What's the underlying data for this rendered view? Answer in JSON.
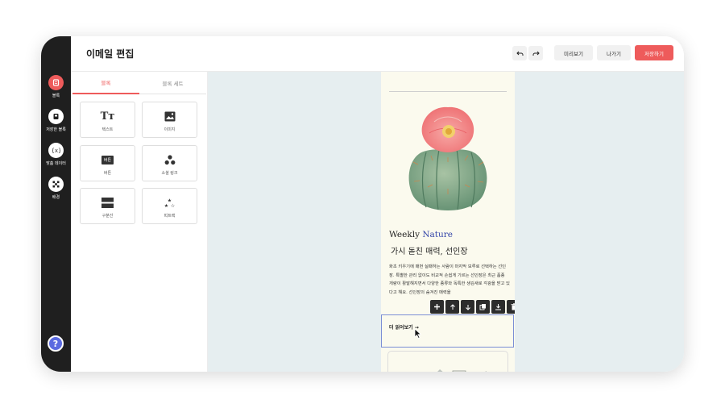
{
  "header": {
    "title": "이메일 편집",
    "preview_label": "미리보기",
    "exit_label": "나가기",
    "save_label": "저장하기"
  },
  "rail": {
    "items": [
      {
        "label": "블록",
        "icon": "block-icon",
        "active": true
      },
      {
        "label": "저장한 블록",
        "icon": "saved-block-icon",
        "active": false
      },
      {
        "label": "맞춤 데이터",
        "icon": "custom-data-icon",
        "active": false
      },
      {
        "label": "배경",
        "icon": "background-icon",
        "active": false
      }
    ],
    "help_label": "?"
  },
  "panel": {
    "tabs": [
      {
        "label": "블록",
        "active": true
      },
      {
        "label": "블록 세트",
        "active": false
      }
    ],
    "tiles": [
      {
        "label": "텍스트",
        "icon": "text-icon",
        "glyph": "Tт"
      },
      {
        "label": "이미지",
        "icon": "image-icon"
      },
      {
        "label": "버튼",
        "icon": "button-icon",
        "glyph": "버튼"
      },
      {
        "label": "소셜 링크",
        "icon": "social-link-icon"
      },
      {
        "label": "구분선",
        "icon": "divider-icon"
      },
      {
        "label": "띠트랙",
        "icon": "stars-icon"
      }
    ]
  },
  "email": {
    "title_prefix": "Weekly ",
    "title_accent": "Nature",
    "subtitle": "가시 돋친 매력, 선인장",
    "body": "화초 키우기에 매번 실패하는 사람이 마지막 보루로 선택하는 선인장. 특별한 관리 없이도 비교적 손쉽게 기르는 선인장은 최근 품종 개량이 활발해지면서 다양한 종류와 독특한 생김새로 각광을 받고 있다고 해요. 선인장의 숨겨진 매력을",
    "more_link": "더 읽어보기 →"
  },
  "block_toolbar": [
    {
      "icon": "plus-icon"
    },
    {
      "icon": "arrow-up-icon"
    },
    {
      "icon": "arrow-down-icon"
    },
    {
      "icon": "copy-icon"
    },
    {
      "icon": "save-icon"
    },
    {
      "icon": "trash-icon"
    }
  ],
  "colors": {
    "accent": "#ee5b5b",
    "rail": "#1f1f1f",
    "canvas": "#e6eef0",
    "email_bg": "#fbfaee",
    "link_blue": "#3344a8",
    "help": "#5b6ae0"
  }
}
